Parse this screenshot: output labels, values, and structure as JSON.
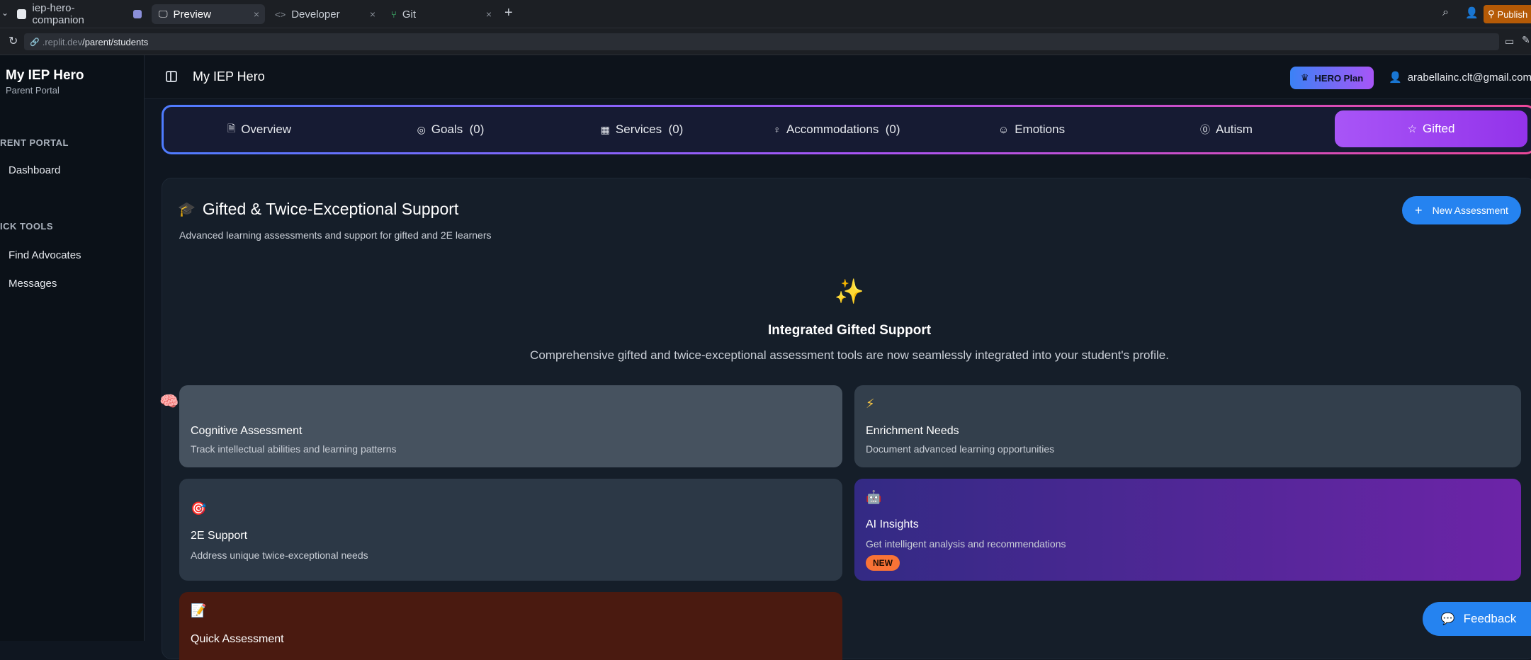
{
  "browser": {
    "tabs": [
      {
        "label": "iep-hero-companion"
      },
      {
        "label": "Preview"
      },
      {
        "label": "Developer"
      },
      {
        "label": "Git"
      }
    ],
    "publish_label": "Publish",
    "url_host": ".replit.dev",
    "url_path": "/parent/students"
  },
  "sidebar": {
    "title": "My IEP Hero",
    "subtitle": "Parent Portal",
    "sections": [
      {
        "label": "RENT PORTAL",
        "items": [
          {
            "label": "Dashboard"
          }
        ]
      },
      {
        "label": "ICK TOOLS",
        "items": [
          {
            "label": "Find Advocates"
          },
          {
            "label": "Messages"
          }
        ]
      }
    ]
  },
  "header": {
    "title": "My IEP Hero",
    "plan": "HERO Plan",
    "email": "arabellainc.clt@gmail.com"
  },
  "tabs": [
    {
      "label": "Overview",
      "icon": "document-icon"
    },
    {
      "label": "Goals  (0)",
      "icon": "target-icon"
    },
    {
      "label": "Services  (0)",
      "icon": "building-icon"
    },
    {
      "label": "Accommodations  (0)",
      "icon": "lightbulb-icon"
    },
    {
      "label": "Emotions",
      "icon": "smile-icon"
    },
    {
      "label": "Autism",
      "icon": "puzzle-icon"
    },
    {
      "label": "Gifted",
      "icon": "star-icon",
      "active": true
    }
  ],
  "section": {
    "title": "Gifted & Twice-Exceptional Support",
    "subtitle": "Advanced learning assessments and support for gifted and 2E learners",
    "new_button": "New Assessment"
  },
  "integrated": {
    "title": "Integrated Gifted Support",
    "subtitle": "Comprehensive gifted and twice-exceptional assessment tools are now seamlessly integrated into your student's profile."
  },
  "tiles": [
    {
      "title": "Cognitive Assessment",
      "desc": "Track intellectual abilities and learning patterns",
      "icon": "brain-icon"
    },
    {
      "title": "Enrichment Needs",
      "desc": "Document advanced learning opportunities",
      "icon": "lightning-icon"
    },
    {
      "title": "2E Support",
      "desc": "Address unique twice-exceptional needs",
      "icon": "target-icon"
    },
    {
      "title": "AI Insights",
      "desc": "Get intelligent analysis and recommendations",
      "icon": "robot-icon",
      "badge": "NEW"
    },
    {
      "title": "Quick Assessment",
      "desc": "",
      "icon": "memo-icon"
    }
  ],
  "feedback_label": "Feedback"
}
